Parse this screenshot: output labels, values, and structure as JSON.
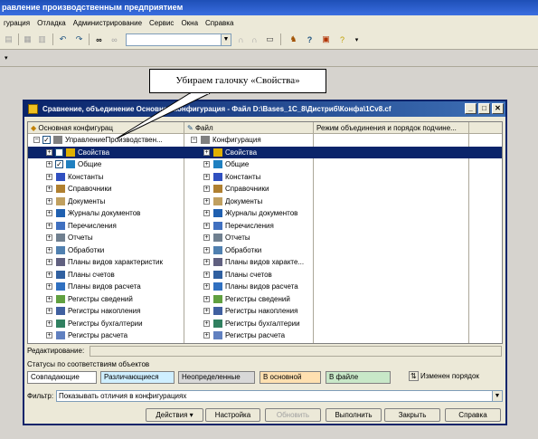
{
  "app": {
    "title": "равление производственным предприятием"
  },
  "menu": [
    "гурация",
    "Отладка",
    "Администрирование",
    "Сервис",
    "Окна",
    "Справка"
  ],
  "callout": "Убираем галочку «Свойства»",
  "dialog": {
    "title": "Сравнение, объединение Основная конфигурация - Файл D:\\Bases_1C_8\\Дистриб\\Конфа\\1Cv8.cf",
    "columns": {
      "left": "Основная конфигурац",
      "right": "Файл",
      "mode": "Режим объединения и порядок подчине..."
    },
    "left_root": "УправлениеПроизводствен...",
    "right_root": "Конфигурация",
    "items": [
      "Свойства",
      "Общие",
      "Константы",
      "Справочники",
      "Документы",
      "Журналы документов",
      "Перечисления",
      "Отчеты",
      "Обработки"
    ],
    "left_items_tail": [
      "Планы видов характеристик",
      "Планы счетов",
      "Планы видов расчета",
      "Регистры сведений",
      "Регистры накопления",
      "Регистры бухгалтерии",
      "Регистры расчета"
    ],
    "right_items_tail": [
      "Планы видов характе...",
      "Планы счетов",
      "Планы видов расчета",
      "Регистры сведений",
      "Регистры накопления",
      "Регистры бухгалтерии",
      "Регистры расчета"
    ],
    "edit_label": "Редактирование:",
    "status_label": "Статусы по соответствиям объектов",
    "legend": [
      "Совпадающие",
      "Различающиеся",
      "Неопределенные",
      "В основной",
      "В файле"
    ],
    "changed_order": "Изменен порядок",
    "filter_label": "Фильтр:",
    "filter_value": "Показывать отличия в конфигурациях",
    "buttons": {
      "actions": "Действия",
      "settings": "Настройка",
      "refresh": "Обновить",
      "execute": "Выполнить",
      "close": "Закрыть",
      "help": "Справка"
    }
  },
  "colors": {
    "selection": "#0a246a",
    "title_bar": "#0a246a",
    "legend_diff": "#cfefff",
    "legend_undef": "#d8d8d8",
    "legend_main": "#ffe0b0",
    "legend_file": "#c8e8c8"
  }
}
